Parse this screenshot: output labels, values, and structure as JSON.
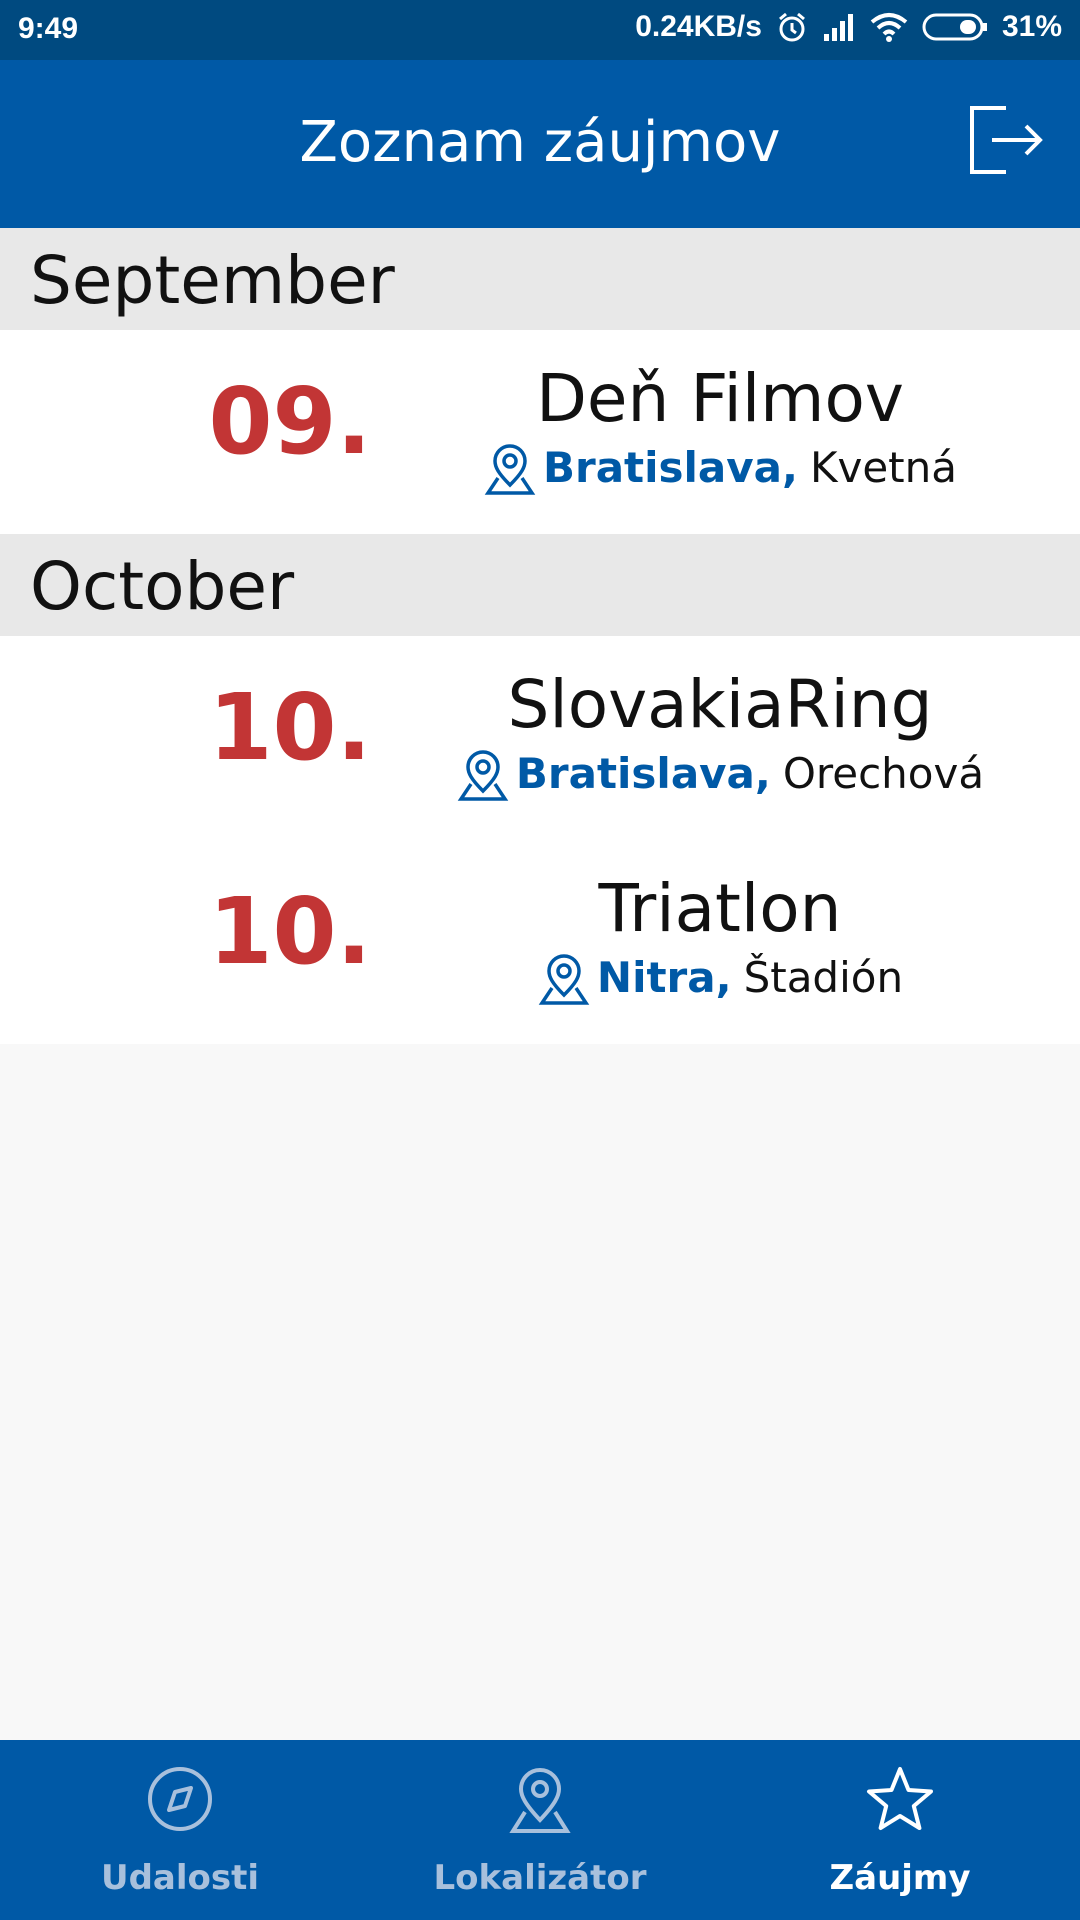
{
  "status_bar": {
    "time": "9:49",
    "network_speed": "0.24KB/s",
    "battery": "31%",
    "icons": [
      "alarm-icon",
      "signal-icon",
      "wifi-icon",
      "battery-icon"
    ]
  },
  "app_bar": {
    "title": "Zoznam záujmov",
    "logout_icon": "logout-icon"
  },
  "colors": {
    "primary": "#0059a6",
    "status_bar": "#004a80",
    "date_red": "#c23535",
    "section_bg": "#e8e8e8"
  },
  "months": [
    {
      "name": "September",
      "events": [
        {
          "day": "09.",
          "title": "Deň Filmov",
          "city": "Bratislava,",
          "place": "Kvetná"
        }
      ]
    },
    {
      "name": "October",
      "events": [
        {
          "day": "10.",
          "title": "SlovakiaRing",
          "city": "Bratislava,",
          "place": "Orechová"
        },
        {
          "day": "10.",
          "title": "Triatlon",
          "city": "Nitra,",
          "place": "Štadión"
        }
      ]
    }
  ],
  "bottom_nav": {
    "items": [
      {
        "label": "Udalosti",
        "icon": "compass-icon",
        "active": false
      },
      {
        "label": "Lokalizátor",
        "icon": "map-pin-icon",
        "active": false
      },
      {
        "label": "Záujmy",
        "icon": "star-icon",
        "active": true
      }
    ]
  }
}
